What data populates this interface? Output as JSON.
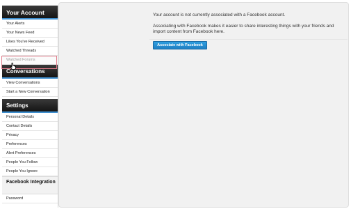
{
  "sidebar": {
    "your_account": {
      "title": "Your Account",
      "items": [
        "Your Alerts",
        "Your News Feed",
        "Likes You've Received",
        "Watched Threads",
        "Watched Forums"
      ]
    },
    "conversations": {
      "title": "Conversations",
      "items": [
        "View Conversations",
        "Start a New Conversation"
      ]
    },
    "settings": {
      "title": "Settings",
      "items": [
        "Personal Details",
        "Contact Details",
        "Privacy",
        "Preferences",
        "Alert Preferences",
        "People You Follow",
        "People You Ignore"
      ]
    },
    "facebook_integration": {
      "title": "Facebook Integration"
    },
    "password": "Password"
  },
  "main": {
    "message_line1": "Your account is not currently associated with a Facebook account.",
    "message_line2": "Associating with Facebook makes it easier to share interesting things with your friends and import content from Facebook here.",
    "associate_button": "Associate with Facebook"
  },
  "colors": {
    "header_bg": "#1f1f1f",
    "accent_blue": "#3f8fcf",
    "highlight_red": "#d94a5a"
  }
}
